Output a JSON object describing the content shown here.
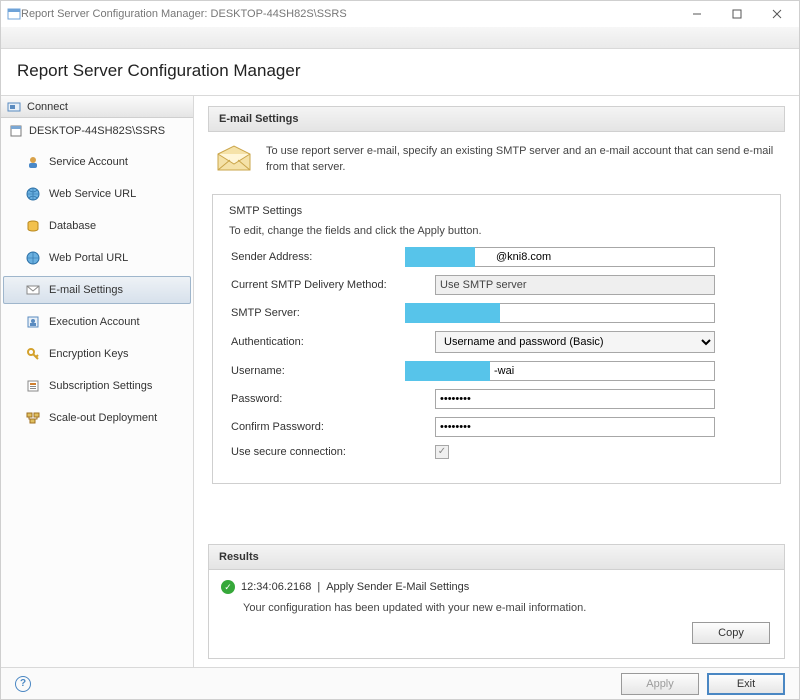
{
  "window": {
    "title": "Report Server Configuration Manager: DESKTOP-44SH82S\\SSRS"
  },
  "header": {
    "title": "Report Server Configuration Manager"
  },
  "sidebar": {
    "connect_label": "Connect",
    "server_label": "DESKTOP-44SH82S\\SSRS",
    "items": [
      {
        "label": "Service Account"
      },
      {
        "label": "Web Service URL"
      },
      {
        "label": "Database"
      },
      {
        "label": "Web Portal URL"
      },
      {
        "label": "E-mail Settings"
      },
      {
        "label": "Execution Account"
      },
      {
        "label": "Encryption Keys"
      },
      {
        "label": "Subscription Settings"
      },
      {
        "label": "Scale-out Deployment"
      }
    ]
  },
  "panel": {
    "title": "E-mail Settings",
    "intro": "To use report server e-mail, specify an existing SMTP server and an e-mail account that can send e-mail from that server.",
    "fieldset_legend": "SMTP Settings",
    "help_text": "To edit, change the fields and click the Apply button.",
    "fields": {
      "sender_label": "Sender Address:",
      "sender_value": "@kni8.com",
      "delivery_label": "Current SMTP Delivery Method:",
      "delivery_value": "Use SMTP server",
      "smtp_label": "SMTP Server:",
      "smtp_value": "",
      "auth_label": "Authentication:",
      "auth_value": "Username and password (Basic)",
      "user_label": "Username:",
      "user_value": "-wai",
      "pass_label": "Password:",
      "pass_value": "••••••••",
      "confirm_label": "Confirm Password:",
      "confirm_value": "••••••••",
      "secure_label": "Use secure connection:"
    }
  },
  "results": {
    "title": "Results",
    "timestamp": "12:34:06.2168",
    "action": "Apply Sender E-Mail Settings",
    "message": "Your configuration has been updated with your new e-mail information.",
    "copy_label": "Copy"
  },
  "footer": {
    "apply_label": "Apply",
    "exit_label": "Exit"
  }
}
